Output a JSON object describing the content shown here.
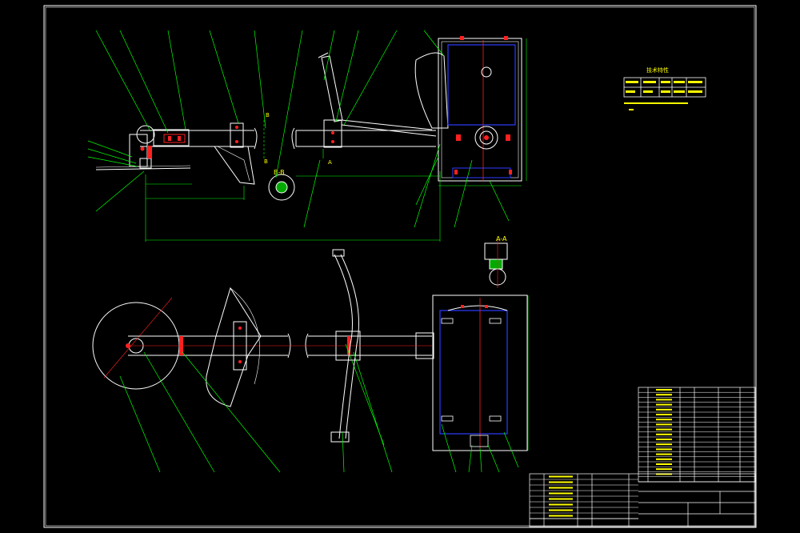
{
  "drawing": {
    "colors": {
      "outline": "#ffffff",
      "leader": "#00ff00",
      "text": "#ffff00",
      "part_blue": "#2b3cff",
      "centerline": "#ff2020",
      "hatch": "#00ff00"
    },
    "section_bb_label": "B-B",
    "section_aa_label": "A-A",
    "section_mark_b_top": "B",
    "section_mark_b_bottom": "B",
    "section_mark_a": "A",
    "tech_title": "技术特性"
  }
}
